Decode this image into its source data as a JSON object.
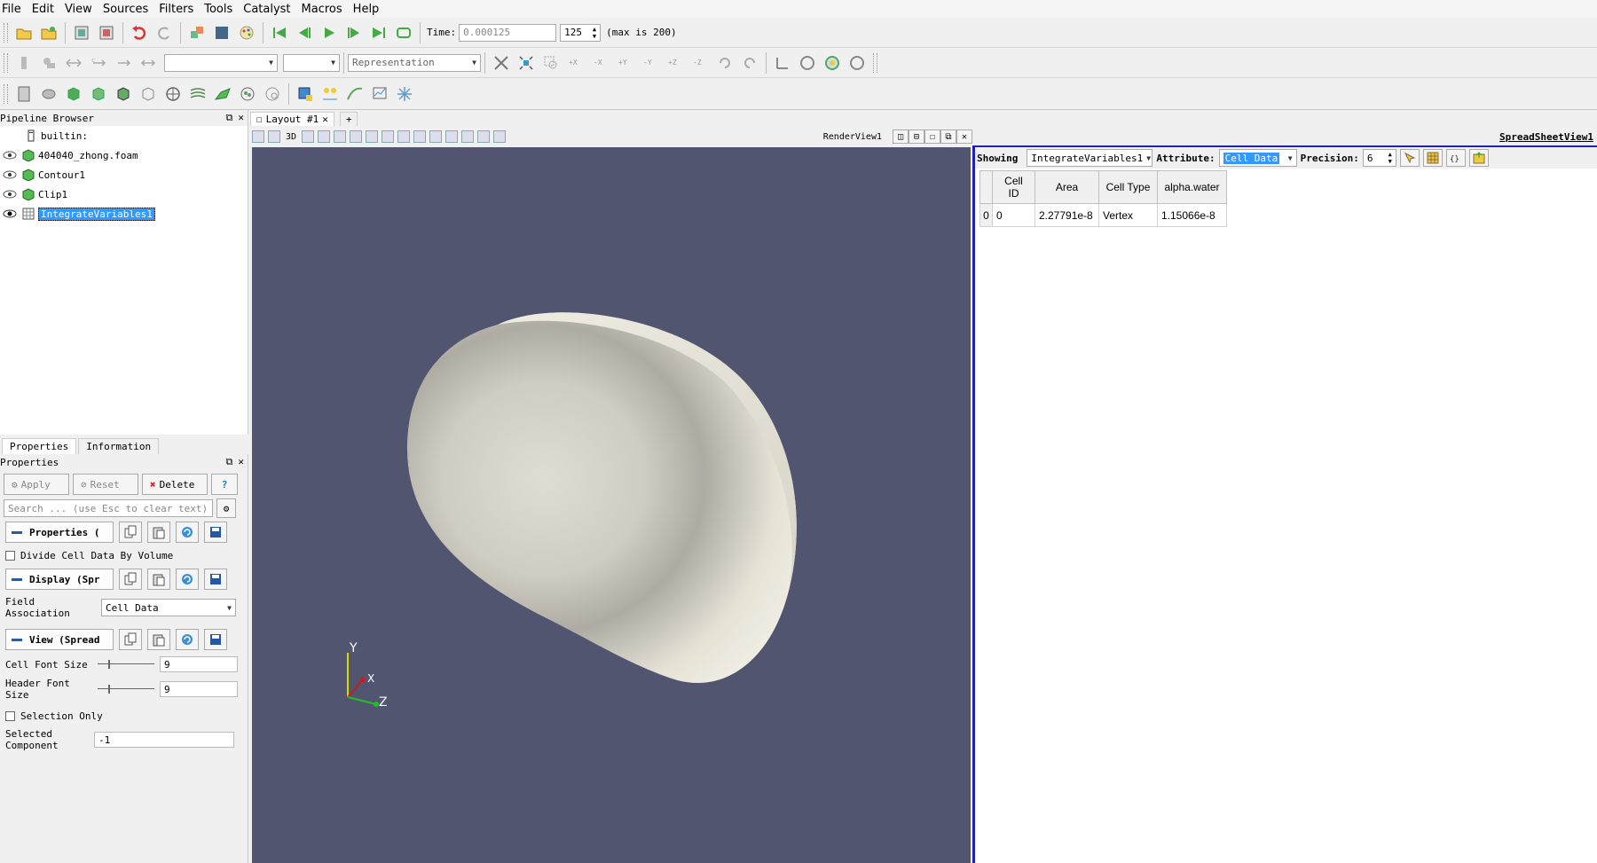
{
  "menu": [
    "File",
    "Edit",
    "View",
    "Sources",
    "Filters",
    "Tools",
    "Catalyst",
    "Macros",
    "Help"
  ],
  "time_toolbar": {
    "time_label": "Time:",
    "time_value": "0.000125",
    "step_value": "125",
    "max_text": "(max is 200)"
  },
  "toolbar2": {
    "representation_placeholder": "Representation"
  },
  "pipeline": {
    "title": "Pipeline Browser",
    "items": [
      {
        "label": "builtin:",
        "visible": false
      },
      {
        "label": "404040_zhong.foam",
        "visible": true
      },
      {
        "label": "Contour1",
        "visible": true
      },
      {
        "label": "Clip1",
        "visible": true
      },
      {
        "label": "IntegrateVariables1",
        "visible": true,
        "selected": true
      }
    ]
  },
  "tabs": [
    "Properties",
    "Information"
  ],
  "properties": {
    "title": "Properties",
    "apply": "Apply",
    "reset": "Reset",
    "delete": "Delete",
    "help": "?",
    "search_placeholder": "Search ... (use Esc to clear text)",
    "section_properties": "Properties (",
    "divide_cell_data": "Divide Cell Data By Volume",
    "section_display": "Display (Spr",
    "field_association_label": "Field Association",
    "field_association_value": "Cell Data",
    "section_view": "View (Spread",
    "cell_font_size_label": "Cell Font Size",
    "cell_font_size": "9",
    "header_font_size_label": "Header Font Size",
    "header_font_size": "9",
    "selection_only": "Selection Only",
    "selected_component_label_1": "Selected",
    "selected_component_label_2": "Component",
    "selected_component": "-1"
  },
  "layout": {
    "tab_label": "Layout #1",
    "add_tab": "+",
    "render_view_label": "RenderView1",
    "toggle_3d": "3D"
  },
  "axes": {
    "x": "X",
    "y": "Y",
    "z": "Z"
  },
  "spreadsheet": {
    "title": "SpreadSheetView1",
    "showing_label": "Showing",
    "showing_value": "IntegrateVariables1",
    "attribute_label": "Attribute:",
    "attribute_value": "Cell Data",
    "precision_label": "Precision:",
    "precision_value": "6",
    "columns": [
      "Cell ID",
      "Area",
      "Cell Type",
      "alpha.water"
    ],
    "rows": [
      {
        "index": "0",
        "cells": [
          "0",
          "2.27791e-8",
          "Vertex",
          "1.15066e-8"
        ]
      }
    ]
  },
  "colors": {
    "render_bg": "#525570",
    "surface": "#e8e4d8",
    "selection": "#3399ff",
    "active_view_border": "#2020c0"
  }
}
